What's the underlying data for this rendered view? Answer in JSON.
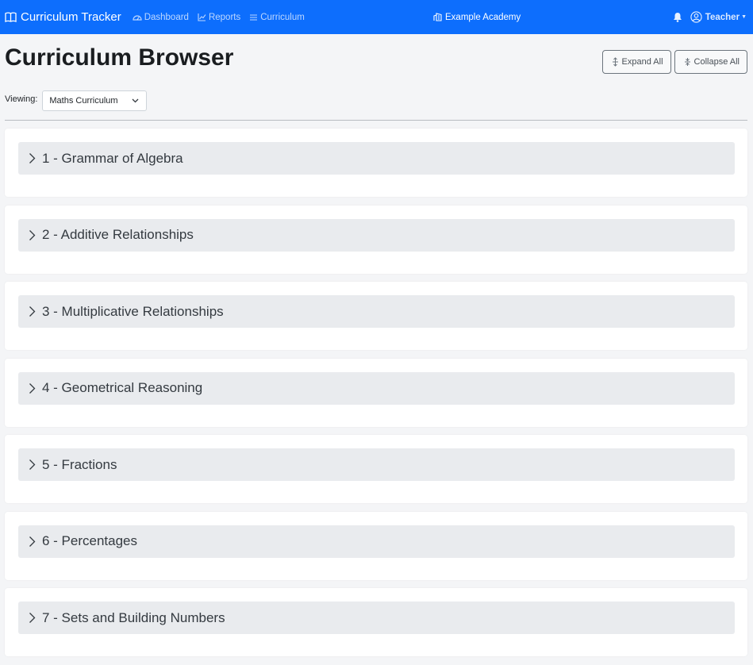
{
  "navbar": {
    "brand": "Curriculum Tracker",
    "links": [
      {
        "label": "Dashboard",
        "icon": "speedometer-icon"
      },
      {
        "label": "Reports",
        "icon": "graph-icon"
      },
      {
        "label": "Curriculum",
        "icon": "list-icon"
      }
    ],
    "school": "Example Academy",
    "user": "Teacher"
  },
  "page": {
    "title": "Curriculum Browser",
    "expand_label": "Expand All",
    "collapse_label": "Collapse All",
    "viewing_label": "Viewing:",
    "selected_curriculum": "Maths Curriculum"
  },
  "units": [
    {
      "label": "1 - Grammar of Algebra"
    },
    {
      "label": "2 - Additive Relationships"
    },
    {
      "label": "3 - Multiplicative Relationships"
    },
    {
      "label": "4 - Geometrical Reasoning"
    },
    {
      "label": "5 - Fractions"
    },
    {
      "label": "6 - Percentages"
    },
    {
      "label": "7 - Sets and Building Numbers"
    }
  ],
  "colors": {
    "navbar": "#0d6efd",
    "unit_header": "#e9ebee"
  }
}
